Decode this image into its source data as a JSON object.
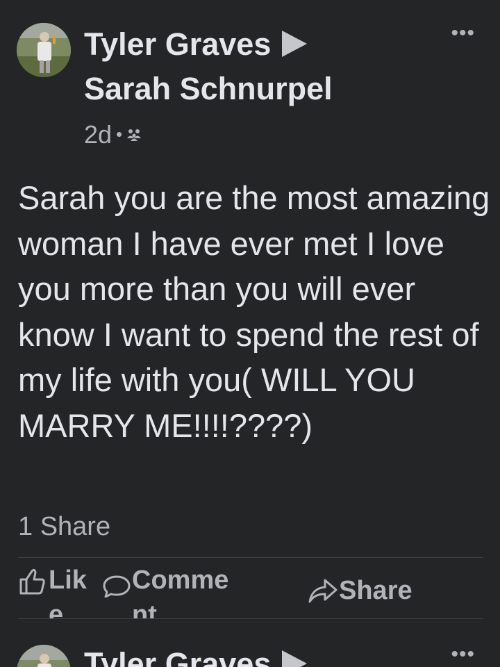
{
  "post": {
    "author": "Tyler Graves",
    "recipient": "Sarah Schnurpel",
    "time": "2d",
    "audience_icon": "friends-icon",
    "more_icon": "•••",
    "text": "Sarah you are the most amazing woman I have ever met I love you more than you will ever know I want to spend the rest of my life with you( WILL YOU MARRY ME!!!!????)",
    "shares": "1 Share",
    "actions": {
      "like": "Like",
      "comment": "Comment",
      "share": "Share"
    }
  },
  "next_post": {
    "author": "Tyler Graves",
    "more_icon": "•••"
  },
  "colors": {
    "background": "#242526",
    "primary_text": "#e4e6eb",
    "secondary_text": "#b0b3b8",
    "divider": "#3e4042"
  }
}
